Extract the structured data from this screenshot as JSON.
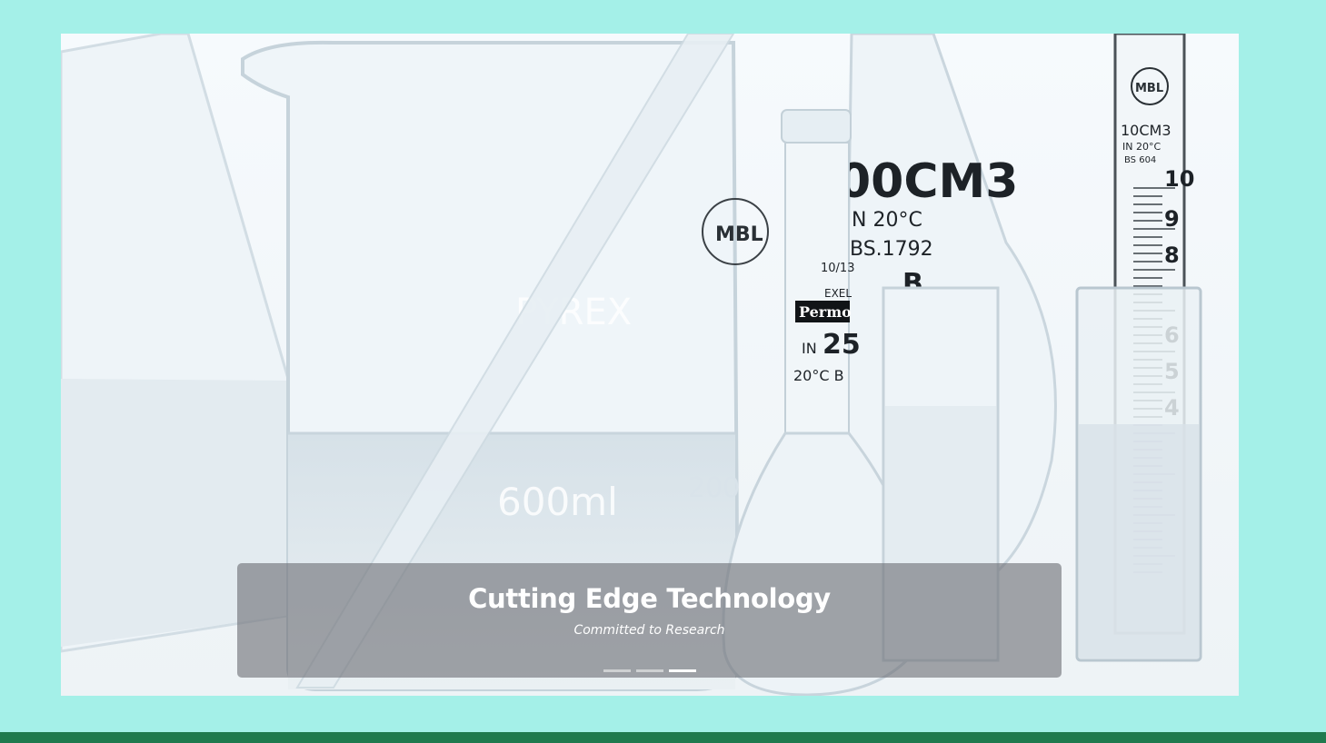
{
  "carousel": {
    "slide_image": "laboratory-glassware-photo",
    "caption": {
      "title": "Cutting Edge Technology",
      "subtitle": "Committed to Research"
    },
    "indicator_count": 3,
    "active_indicator": 3
  },
  "photo_text": {
    "beaker_brand": "PYREX",
    "beaker_volume": "600ml",
    "beaker_mark": "200",
    "flask_volume": "00CM3",
    "flask_temp": "N 20°C",
    "flask_standard": "BS.1792",
    "flask_letter": "B",
    "logo_mbl": "MBL",
    "tube_brand": "Permo",
    "tube_in": "IN",
    "tube_value": "25",
    "tube_temp": "20°C B",
    "tube_fraction": "10/13",
    "tube_exel": "EXEL",
    "cyl_logo": "MBL",
    "cyl_volume": "10CM3",
    "cyl_temp": "IN 20°C",
    "cyl_standard": "BS 604",
    "cyl_marks": [
      "10",
      "9",
      "8",
      "6",
      "5",
      "4"
    ]
  },
  "colors": {
    "page_background": "#a4f0e8",
    "footer_bar": "#1f7a4e",
    "caption_background": "rgba(110,112,118,0.62)"
  }
}
